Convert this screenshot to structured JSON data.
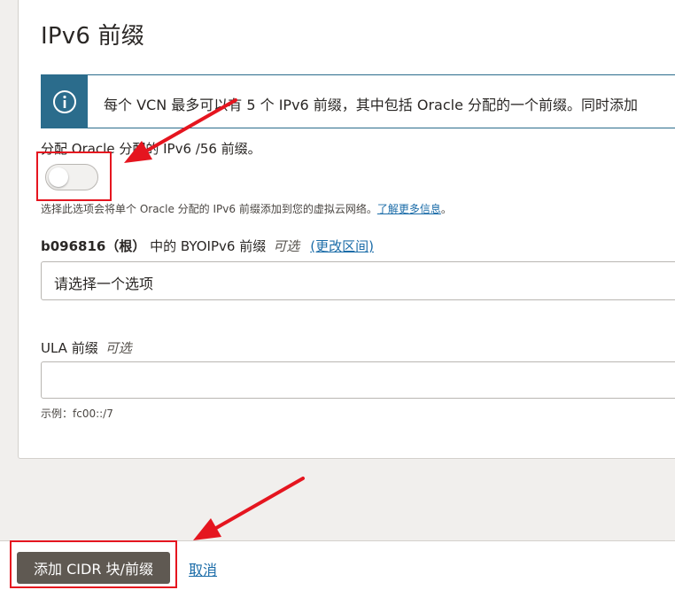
{
  "section": {
    "title": "IPv6 前缀"
  },
  "info_banner": {
    "icon": "info-icon",
    "message": "每个 VCN 最多可以有 5 个 IPv6 前缀，其中包括 Oracle 分配的一个前缀。同时添加"
  },
  "oracle_prefix": {
    "label": "分配 Oracle 分配的 IPv6 /56 前缀。",
    "enabled": false,
    "help_text": "选择此选项会将单个 Oracle 分配的 IPv6 前缀添加到您的虚拟云网络。",
    "learn_more_link": "了解更多信息",
    "help_suffix": "。"
  },
  "byoip": {
    "compartment": "b096816（根）",
    "label_rest": "中的 BYOIPv6 前缀",
    "optional": "可选",
    "change_link": "(更改区间)",
    "select_placeholder": "请选择一个选项"
  },
  "ula": {
    "label": "ULA 前缀",
    "optional": "可选",
    "value": "",
    "help_text": "示例：fc00::/7"
  },
  "footer": {
    "submit_label": "添加 CIDR 块/前缀",
    "cancel_label": "取消"
  },
  "colors": {
    "accent": "#2b6c8c",
    "link": "#1b6ca8",
    "primary_button": "#5f5952",
    "annotation": "#e5151f"
  }
}
